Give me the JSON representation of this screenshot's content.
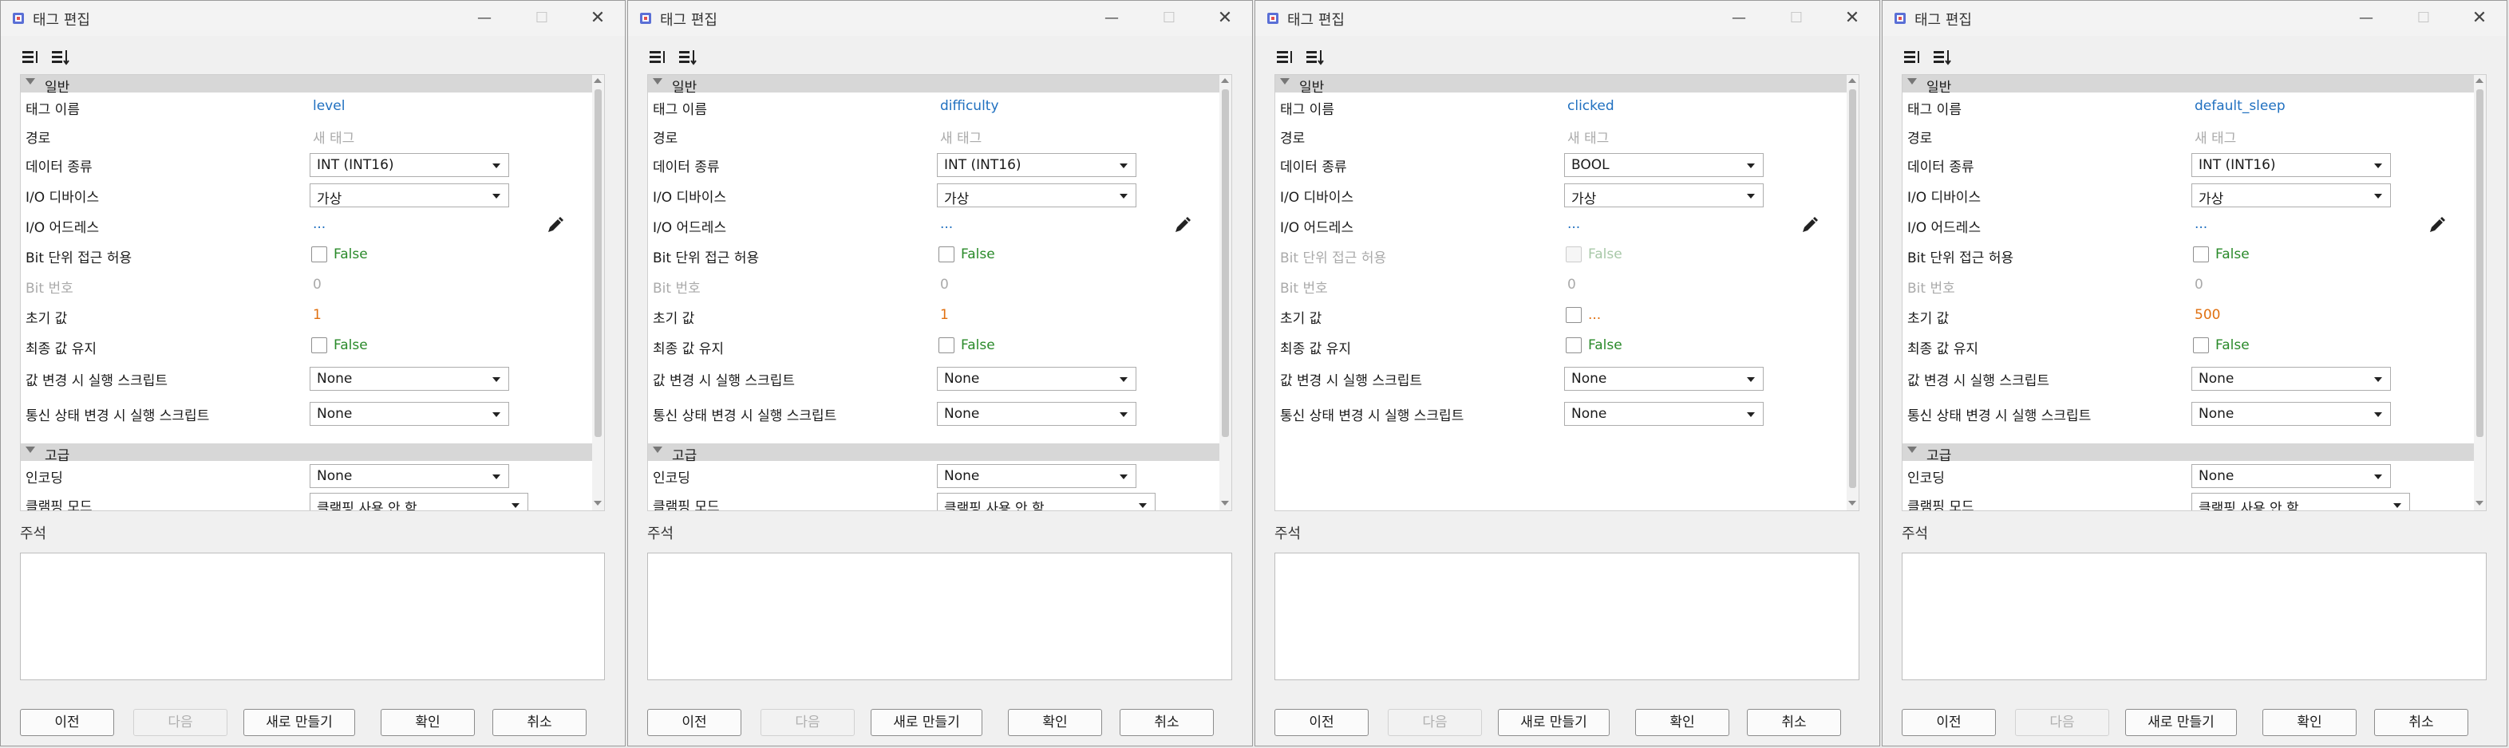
{
  "common": {
    "title": "태그 편집",
    "window_controls": {
      "minimize": "—",
      "maximize": "☐",
      "close": "✕"
    },
    "sections": {
      "general": "일반",
      "advanced": "고급"
    },
    "labels": {
      "tag_name": "태그 이름",
      "path": "경로",
      "data_type": "데이터 종류",
      "io_device": "I/O 디바이스",
      "io_address": "I/O 어드레스",
      "bit_access": "Bit 단위 접근 허용",
      "bit_number": "Bit 번호",
      "initial_value": "초기 값",
      "retain_last": "최종 값 유지",
      "on_change_script": "값 변경 시 실행 스크립트",
      "on_comm_script": "통신 상태 변경 시 실행 스크립트",
      "encoding": "인코딩",
      "clamp_mode": "클램핑 모드"
    },
    "notes_label": "주석",
    "buttons": {
      "prev": "이전",
      "next": "다음",
      "new": "새로 만들기",
      "ok": "확인",
      "cancel": "취소"
    },
    "icons": {
      "app": "app-icon",
      "toolbar_1": "align-left-icon",
      "toolbar_2": "sort-icon",
      "edit": "pencil-icon"
    }
  },
  "windows": [
    {
      "tag_name": "level",
      "path": "새 태그",
      "data_type": "INT (INT16)",
      "io_device": "가상",
      "io_address": "...",
      "bit_access": "False",
      "bit_number": "0",
      "initial_value": "1",
      "retain_last": "False",
      "on_change_script": "None",
      "on_comm_script": "None",
      "encoding": "None",
      "clamp_mode": "클램핑 사용 안 함"
    },
    {
      "tag_name": "difficulty",
      "path": "새 태그",
      "data_type": "INT (INT16)",
      "io_device": "가상",
      "io_address": "...",
      "bit_access": "False",
      "bit_number": "0",
      "initial_value": "1",
      "retain_last": "False",
      "on_change_script": "None",
      "on_comm_script": "None",
      "encoding": "None",
      "clamp_mode": "클램핑 사용 안 함"
    },
    {
      "tag_name": "clicked",
      "path": "새 태그",
      "data_type": "BOOL",
      "io_device": "가상",
      "io_address": "...",
      "bit_access": "False",
      "bit_number": "0",
      "initial_value": "...",
      "retain_last": "False",
      "on_change_script": "None",
      "on_comm_script": "None"
    },
    {
      "tag_name": "default_sleep",
      "path": "새 태그",
      "data_type": "INT (INT16)",
      "io_device": "가상",
      "io_address": "...",
      "bit_access": "False",
      "bit_number": "0",
      "initial_value": "500",
      "retain_last": "False",
      "on_change_script": "None",
      "on_comm_script": "None",
      "encoding": "None",
      "clamp_mode": "클램핑 사용 안 함"
    }
  ]
}
